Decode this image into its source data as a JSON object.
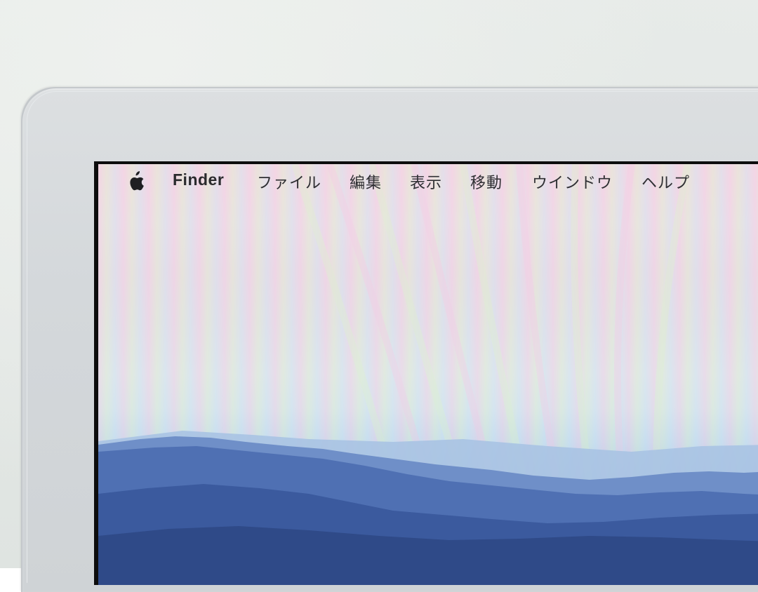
{
  "menubar": {
    "apple_icon": "apple-logo-icon",
    "app_name": "Finder",
    "items": [
      {
        "label": "ファイル"
      },
      {
        "label": "編集"
      },
      {
        "label": "表示"
      },
      {
        "label": "移動"
      },
      {
        "label": "ウインドウ"
      },
      {
        "label": "ヘルプ"
      }
    ]
  },
  "colors": {
    "bezel": "#d4d8db",
    "screen_border": "#0d0d0d",
    "menu_text": "#2f2f33",
    "sky_top": "#f4dce6",
    "mountain": "#3c5fa8"
  }
}
